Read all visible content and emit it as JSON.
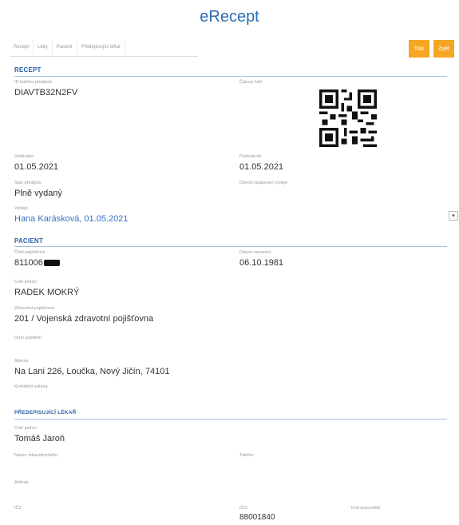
{
  "header": {
    "title": "eRecept"
  },
  "tabs": [
    "Recept",
    "Léky",
    "Pacient",
    "Předepisující lékař"
  ],
  "buttons": {
    "print": "Tisk",
    "export": "Zpět"
  },
  "recept": {
    "section": "RECEPT",
    "id_label": "ID balíčku předpisů",
    "id_value": "DIAVTB32N2FV",
    "qr_label": "Čárový kód",
    "issued_label": "Vydáváno",
    "issued_value": "01.05.2021",
    "valid_label": "Platnost do",
    "valid_value": "01.05.2021",
    "state_label": "Stav předpisu",
    "state_value": "Plně vydaný",
    "reason_label": "Důvod opakovaní výdeje",
    "dispense_label": "Výdeje",
    "dispense_value": "Hana Karásková, 01.05.2021"
  },
  "pacient": {
    "section": "PACIENT",
    "insurance_no_label": "Číslo pojištěnce",
    "insurance_no_value": "811006",
    "birth_label": "Datum narození",
    "birth_value": "06.10.1981",
    "name_label": "Celé jméno",
    "name_value": "RADEK MOKRÝ",
    "insurer_label": "Zdravotní pojišťovna",
    "insurer_value": "201 / Vojenská zdravotní pojišťovna",
    "type_label": "Druh pojištění",
    "address_label": "Adresa",
    "address_value": "Na Lani 226, Loučka, Nový Jičín, 74101",
    "contact_label": "Kontaktní adresa"
  },
  "lekar": {
    "section": "PŘEDEPISUJÍCÍ LÉKAŘ",
    "name_label": "Celé jméno",
    "name_value": "Tomáš Jaroň",
    "facility_label": "Název zdravotnického",
    "phone_label": "Telefon",
    "address_label": "Adresa",
    "icz_label": "IČZ",
    "ico_label": "IČO",
    "ico_value": "88001840",
    "code_label": "Kód pracoviště"
  },
  "colors": {
    "accent": "#f5a623",
    "link": "#3a72c0",
    "section": "#2a5fa5"
  }
}
